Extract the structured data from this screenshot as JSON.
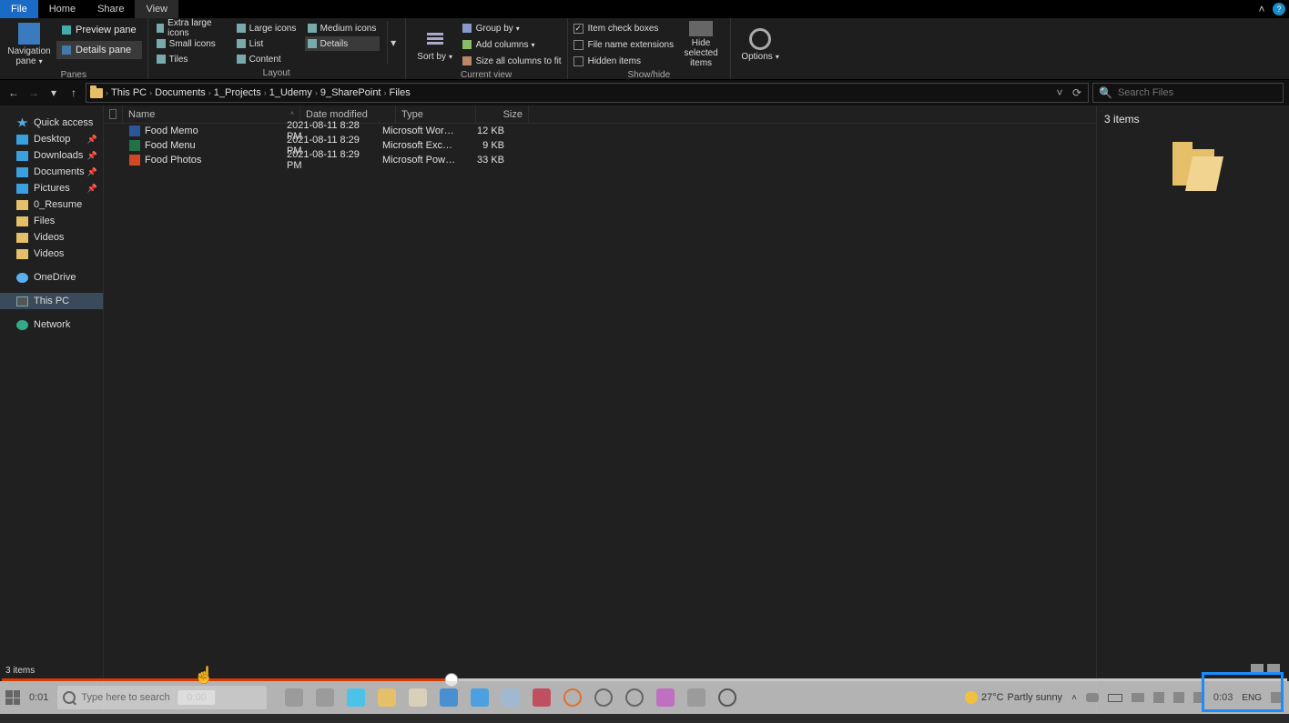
{
  "tabs": {
    "file": "File",
    "home": "Home",
    "share": "Share",
    "view": "View"
  },
  "ribbon": {
    "panes": {
      "nav": "Navigation pane",
      "preview": "Preview pane",
      "details": "Details pane",
      "group_label": "Panes"
    },
    "layout": {
      "extra_large": "Extra large icons",
      "large": "Large icons",
      "medium": "Medium icons",
      "small": "Small icons",
      "list": "List",
      "details": "Details",
      "tiles": "Tiles",
      "content": "Content",
      "group_label": "Layout"
    },
    "currentview": {
      "sort_by": "Sort by",
      "group_by": "Group by",
      "add_columns": "Add columns",
      "size_all": "Size all columns to fit",
      "group_label": "Current view"
    },
    "showhide": {
      "item_check": "Item check boxes",
      "file_ext": "File name extensions",
      "hidden": "Hidden items",
      "hide_selected": "Hide selected items",
      "group_label": "Show/hide"
    },
    "options": "Options"
  },
  "breadcrumb": [
    "This PC",
    "Documents",
    "1_Projects",
    "1_Udemy",
    "9_SharePoint",
    "Files"
  ],
  "search_placeholder": "Search Files",
  "sidebar": {
    "quick": "Quick access",
    "desktop": "Desktop",
    "downloads": "Downloads",
    "documents": "Documents",
    "pictures": "Pictures",
    "resume": "0_Resume",
    "files": "Files",
    "videos1": "Videos",
    "videos2": "Videos",
    "onedrive": "OneDrive",
    "thispc": "This PC",
    "network": "Network"
  },
  "columns": {
    "name": "Name",
    "date": "Date modified",
    "type": "Type",
    "size": "Size"
  },
  "files": [
    {
      "name": "Food Memo",
      "date": "2021-08-11 8:28 PM",
      "type": "Microsoft Word D…",
      "size": "12 KB",
      "app": "word"
    },
    {
      "name": "Food Menu",
      "date": "2021-08-11 8:29 PM",
      "type": "Microsoft Excel W…",
      "size": "9 KB",
      "app": "excel"
    },
    {
      "name": "Food Photos",
      "date": "2021-08-11 8:29 PM",
      "type": "Microsoft PowerP…",
      "size": "33 KB",
      "app": "ppt"
    }
  ],
  "preview": {
    "count": "3 items"
  },
  "status_bar": "3 items",
  "video": {
    "tooltip": "0:00",
    "left_time": "0:01",
    "right_time": "0:03",
    "search_placeholder": "Type here to search"
  },
  "systray": {
    "weather_temp": "27°C",
    "weather_desc": "Partly sunny",
    "lang": "ENG"
  }
}
